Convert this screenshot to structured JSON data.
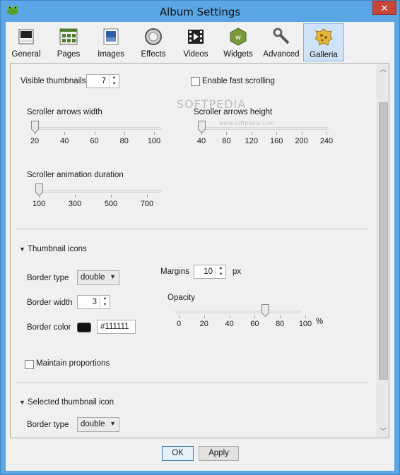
{
  "window": {
    "title": "Album Settings",
    "close_glyph": "✕"
  },
  "tabs": [
    {
      "label": "General",
      "icon": "general-icon"
    },
    {
      "label": "Pages",
      "icon": "pages-icon"
    },
    {
      "label": "Images",
      "icon": "images-icon"
    },
    {
      "label": "Effects",
      "icon": "effects-icon"
    },
    {
      "label": "Videos",
      "icon": "videos-icon"
    },
    {
      "label": "Widgets",
      "icon": "widgets-icon"
    },
    {
      "label": "Advanced",
      "icon": "advanced-icon"
    },
    {
      "label": "Galleria",
      "icon": "galleria-icon",
      "active": true
    }
  ],
  "visible_thumbnails": {
    "label": "Visible thumbnails",
    "value": "7"
  },
  "fast_scrolling": {
    "label": "Enable fast scrolling",
    "checked": false
  },
  "scroller_arrows_width": {
    "label": "Scroller arrows width",
    "ticks": [
      "20",
      "40",
      "60",
      "80",
      "100"
    ],
    "value": 20
  },
  "scroller_arrows_height": {
    "label": "Scroller arrows height",
    "ticks": [
      "40",
      "80",
      "120",
      "160",
      "200",
      "240"
    ],
    "value": 40
  },
  "scroller_animation_duration": {
    "label": "Scroller animation duration",
    "ticks": [
      "100",
      "300",
      "500",
      "700"
    ],
    "value": 100
  },
  "thumbnail_icons": {
    "section_label": "Thumbnail icons",
    "border_type": {
      "label": "Border type",
      "value": "double"
    },
    "border_width": {
      "label": "Border width",
      "value": "3"
    },
    "border_color": {
      "label": "Border color",
      "value": "#111111",
      "swatch": "#111111"
    },
    "margins": {
      "label": "Margins",
      "value": "10",
      "unit": "px"
    },
    "opacity": {
      "label": "Opacity",
      "ticks": [
        "0",
        "20",
        "40",
        "60",
        "80",
        "100"
      ],
      "value": 68,
      "unit": "%"
    },
    "maintain_proportions": {
      "label": "Maintain proportions",
      "checked": false
    }
  },
  "selected_thumbnail_icon": {
    "section_label": "Selected thumbnail icon",
    "border_type": {
      "label": "Border type",
      "value": "double"
    }
  },
  "watermark": {
    "text": "SOFTPEDIA",
    "url": "www.softpedia.com"
  },
  "buttons": {
    "ok": "OK",
    "apply": "Apply"
  },
  "colors": {
    "titlebar": "#5aa5e3",
    "close": "#c7463a",
    "active_tab": "#cfe3f8"
  }
}
